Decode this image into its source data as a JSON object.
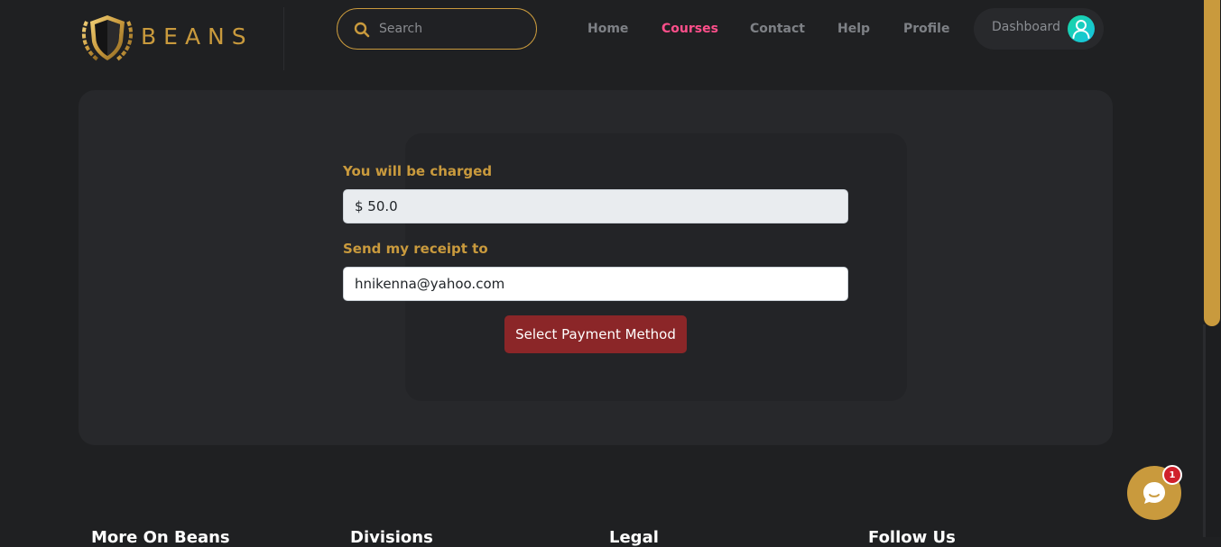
{
  "brand": {
    "name": "BEANS"
  },
  "search": {
    "placeholder": "Search"
  },
  "nav": [
    {
      "label": "Home",
      "active": false
    },
    {
      "label": "Courses",
      "active": true
    },
    {
      "label": "Contact",
      "active": false
    },
    {
      "label": "Help",
      "active": false
    },
    {
      "label": "Profile",
      "active": false
    }
  ],
  "dashboard": {
    "label": "Dashboard"
  },
  "payment": {
    "charge_label": "You will be charged",
    "charge_value": "$ 50.0",
    "receipt_label": "Send my receipt to",
    "receipt_value": "hnikenna@yahoo.com",
    "button_label": "Select Payment Method"
  },
  "footer": {
    "headings": [
      "More On Beans",
      "Divisions",
      "Legal",
      "Follow Us"
    ]
  },
  "chat": {
    "badge_count": "1"
  },
  "colors": {
    "accent": "#c99a3d",
    "active_nav": "#ff4f8b",
    "button": "#8b2628",
    "background": "#1f2022"
  }
}
